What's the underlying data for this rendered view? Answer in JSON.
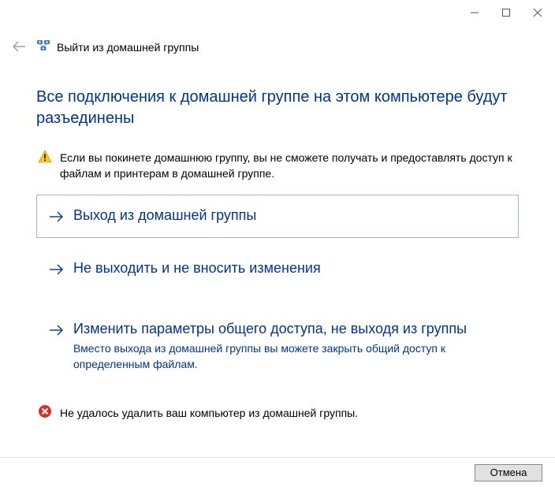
{
  "window": {
    "title": "Выйти из домашней группы"
  },
  "headline": "Все подключения к домашней группе на этом компьютере будут разъединены",
  "warning": "Если вы покинете домашнюю группу, вы не сможете получать и предоставлять доступ к файлам и принтерам в домашней группе.",
  "options": {
    "leave": {
      "title": "Выход из домашней группы"
    },
    "stay": {
      "title": "Не выходить и не вносить изменения"
    },
    "change": {
      "title": "Изменить параметры общего доступа, не выходя из группы",
      "subtitle": "Вместо выхода из домашней  группы вы можете закрыть общий доступ к определенным файлам."
    }
  },
  "error": "Не удалось удалить ваш компьютер из домашней группы.",
  "buttons": {
    "cancel": "Отмена"
  },
  "colors": {
    "accent": "#003399"
  }
}
